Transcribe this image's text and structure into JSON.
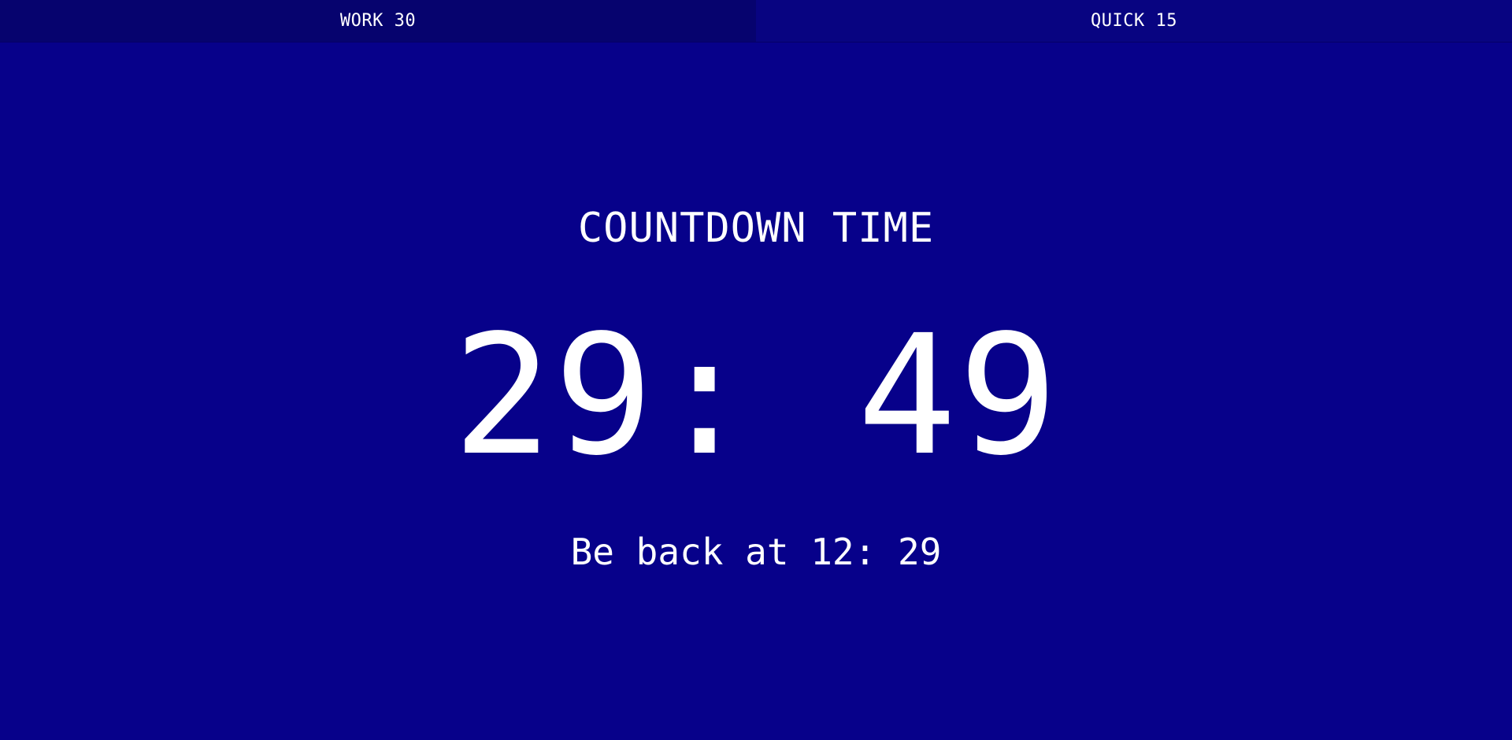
{
  "tabs": [
    {
      "label": "WORK 30",
      "active": true
    },
    {
      "label": "QUICK 15",
      "active": false
    }
  ],
  "timer": {
    "heading": "COUNTDOWN TIME",
    "remaining": "29: 49",
    "return_note": "Be back at 12: 29"
  },
  "colors": {
    "background": "#07018a",
    "active_tab": "#06036e",
    "inactive_tab": "#080481",
    "text": "#ffffff"
  }
}
